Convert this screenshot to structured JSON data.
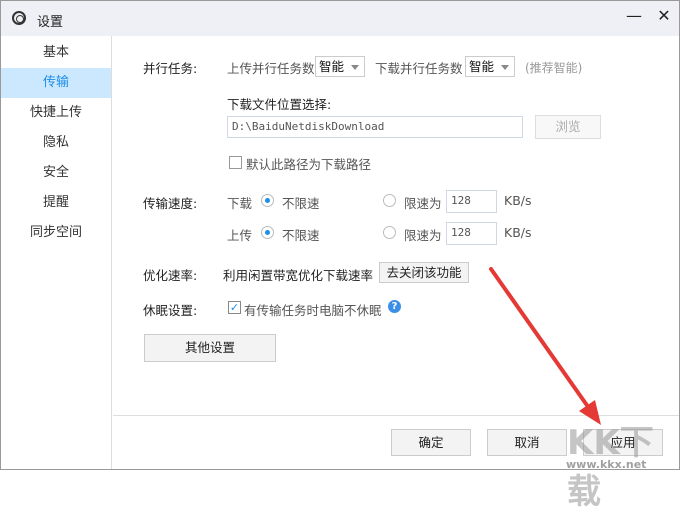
{
  "window": {
    "title": "设置",
    "minimize": "—",
    "close": "✕"
  },
  "sidebar": {
    "items": [
      {
        "label": "基本"
      },
      {
        "label": "传输",
        "active": true
      },
      {
        "label": "快捷上传"
      },
      {
        "label": "隐私"
      },
      {
        "label": "安全"
      },
      {
        "label": "提醒"
      },
      {
        "label": "同步空间"
      }
    ]
  },
  "parallel": {
    "label": "并行任务:",
    "upload_label": "上传并行任务数",
    "upload_value": "智能",
    "download_label": "下载并行任务数",
    "download_value": "智能",
    "hint": "(推荐智能)"
  },
  "location": {
    "label": "下载文件位置选择:",
    "path": "D:\\BaiduNetdiskDownload",
    "browse": "浏览",
    "default_checkbox": "默认此路径为下载路径",
    "default_checked": false
  },
  "speed": {
    "label": "传输速度:",
    "rows": [
      {
        "name": "下载",
        "unlimited": "不限速",
        "limit": "限速为",
        "value": "128",
        "unit": "KB/s",
        "selected": "unlimited"
      },
      {
        "name": "上传",
        "unlimited": "不限速",
        "limit": "限速为",
        "value": "128",
        "unit": "KB/s",
        "selected": "unlimited"
      }
    ]
  },
  "optimize": {
    "label": "优化速率:",
    "text": "利用闲置带宽优化下载速率",
    "button": "去关闭该功能"
  },
  "sleep": {
    "label": "休眠设置:",
    "checkbox": "有传输任务时电脑不休眠",
    "checked": true,
    "help": "?"
  },
  "other_button": "其他设置",
  "footer": {
    "ok": "确定",
    "cancel": "取消",
    "apply": "应用"
  },
  "watermark": {
    "logo": "KK下载",
    "url": "www.kkx.net"
  },
  "colors": {
    "accent": "#1e8ee6",
    "selected_bg": "#cce8ff",
    "arrow": "#e53935"
  }
}
